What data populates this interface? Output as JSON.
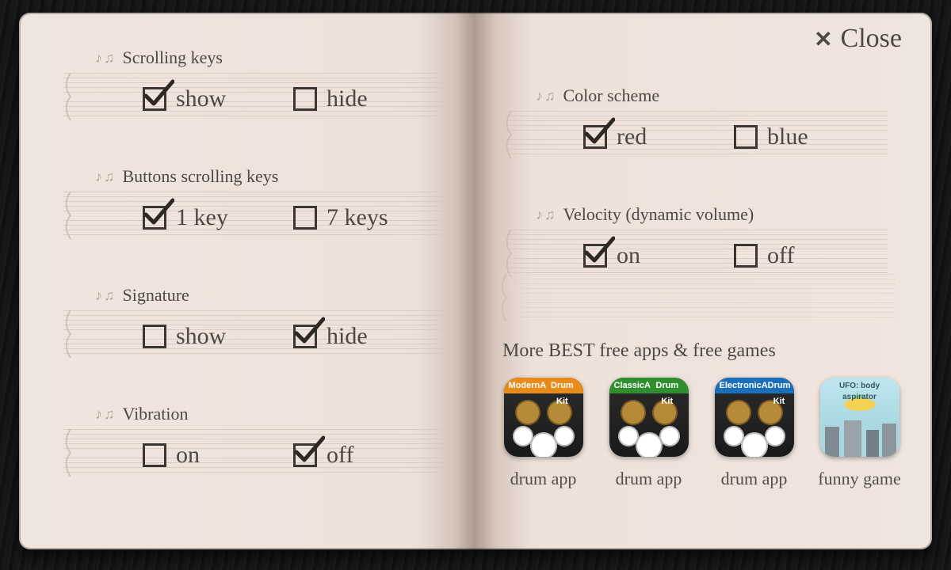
{
  "close_label": "Close",
  "left": {
    "sections": [
      {
        "title": "Scrolling keys",
        "opts": [
          {
            "label": "show",
            "checked": true
          },
          {
            "label": "hide",
            "checked": false
          }
        ]
      },
      {
        "title": "Buttons scrolling keys",
        "opts": [
          {
            "label": "1 key",
            "checked": true
          },
          {
            "label": "7 keys",
            "checked": false
          }
        ]
      },
      {
        "title": "Signature",
        "opts": [
          {
            "label": "show",
            "checked": false
          },
          {
            "label": "hide",
            "checked": true
          }
        ]
      },
      {
        "title": "Vibration",
        "opts": [
          {
            "label": "on",
            "checked": false
          },
          {
            "label": "off",
            "checked": true
          }
        ]
      }
    ]
  },
  "right": {
    "sections": [
      {
        "title": "Color scheme",
        "opts": [
          {
            "label": "red",
            "checked": true
          },
          {
            "label": "blue",
            "checked": false
          }
        ]
      },
      {
        "title": "Velocity (dynamic volume)",
        "opts": [
          {
            "label": "on",
            "checked": true
          },
          {
            "label": "off",
            "checked": false
          }
        ]
      }
    ]
  },
  "promo": {
    "title": "More BEST free apps & free games",
    "apps": [
      {
        "caption": "drum app",
        "kind": "drums",
        "bar_color": "#e88b1a",
        "bar_left": "Modern",
        "bar_right": "Drum Kit"
      },
      {
        "caption": "drum app",
        "kind": "drums",
        "bar_color": "#2f8f2f",
        "bar_left": "Classic",
        "bar_right": "Drum Kit"
      },
      {
        "caption": "drum app",
        "kind": "drums",
        "bar_color": "#1a6fb8",
        "bar_left": "Electronic",
        "bar_right": "Drum Kit"
      },
      {
        "caption": "funny game",
        "kind": "ufo",
        "bar_text": "UFO: body aspirator"
      }
    ]
  },
  "notes_glyph": "♪♫"
}
